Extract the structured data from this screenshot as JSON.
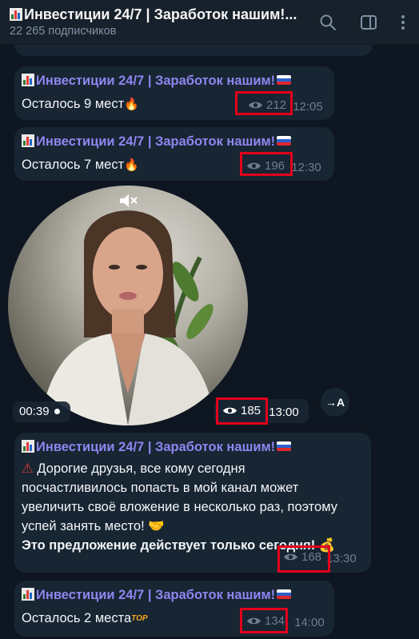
{
  "header": {
    "title": "Инвестиции 24/7 | Заработок нашим!...",
    "subscribers": "22 265 подписчиков"
  },
  "messages": [
    {
      "channel": "Инвестиции 24/7 | Заработок нашим!",
      "text": "Осталось 9 мест",
      "views": "212",
      "time": "12:05"
    },
    {
      "channel": "Инвестиции 24/7 | Заработок нашим!",
      "text": "Осталось 7 мест",
      "views": "196",
      "time": "12:30"
    },
    {
      "video_duration": "00:39",
      "views": "185",
      "time": "13:00",
      "translate_label": "→A"
    },
    {
      "channel": "Инвестиции 24/7 | Заработок нашим!",
      "lines": [
        "Дорогие друзья, все кому сегодня",
        "посчастливилось попасть в мой канал может",
        "увеличить своё вложение в несколько раз, поэтому",
        "успей занять место!"
      ],
      "bold_line": "Это предложение действует только сегодня!",
      "views": "168",
      "time": "13:30"
    },
    {
      "channel": "Инвестиции 24/7 | Заработок нашим!",
      "text": "Осталось 2 места",
      "badge": "TOP",
      "views": "134",
      "time": "14:00"
    }
  ],
  "colors": {
    "background": "#0e1621",
    "bubble": "#182533",
    "accent_name": "#8e86f0",
    "highlight": "#e3001b"
  },
  "icons": [
    "search-icon",
    "sidebar-toggle-icon",
    "kebab-menu-icon",
    "eye-icon",
    "mute-icon",
    "fire-icon",
    "warning-icon",
    "handshake-icon",
    "money-bag-icon",
    "flag-icon",
    "chart-icon"
  ]
}
